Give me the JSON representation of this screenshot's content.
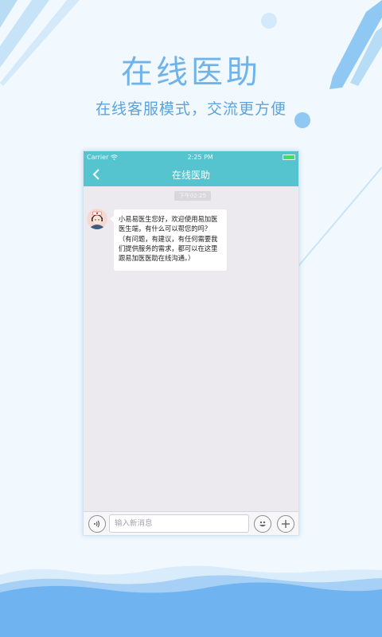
{
  "hero": {
    "title": "在线医助",
    "subtitle": "在线客服模式，交流更方便"
  },
  "status_bar": {
    "carrier": "Carrier",
    "time": "2:25 PM",
    "icons": [
      "wifi-icon",
      "battery-icon"
    ]
  },
  "nav": {
    "back_icon": "chevron-left-icon",
    "title": "在线医助"
  },
  "chat": {
    "timestamp": "下午02:25",
    "messages": [
      {
        "sender": "nurse-avatar",
        "text": "小易易医生您好，欢迎使用易加医医生端，有什么可以帮您的吗？（有问题，有建议，有任何需要我们提供服务的需求，都可以在这里跟易加医医助在线沟通。）"
      }
    ]
  },
  "input_bar": {
    "voice_icon": "voice-icon",
    "placeholder": "输入新消息",
    "value": "",
    "emoji_icon": "smiley-icon",
    "add_icon": "plus-icon"
  },
  "colors": {
    "accent": "#55c4cf",
    "hero_text": "#6fb3ea",
    "background": "#f2f9fe",
    "chat_background": "#eceaef",
    "wave": "#5aa9ee"
  }
}
